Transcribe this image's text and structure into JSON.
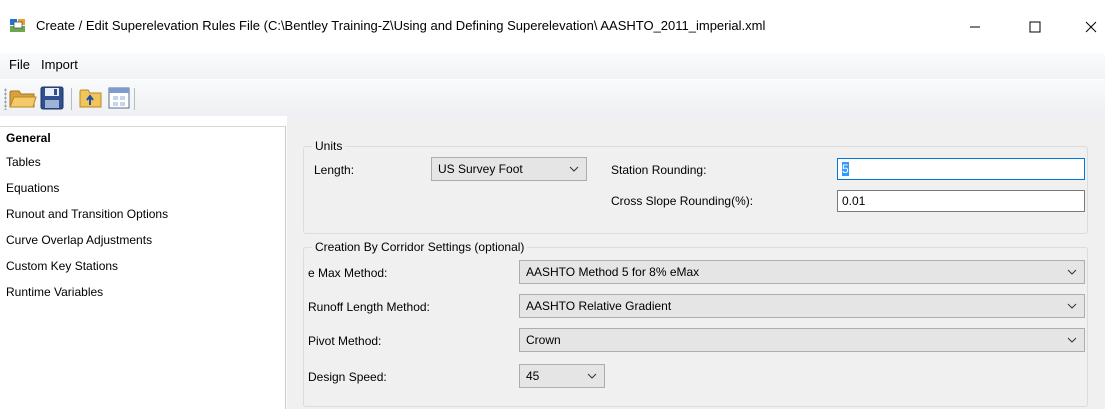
{
  "window": {
    "title": "Create / Edit Superelevation Rules File (C:\\Bentley Training-Z\\Using and Defining Superelevation\\ AASHTO_2011_imperial.xml"
  },
  "menu": {
    "file": "File",
    "import": "Import"
  },
  "toolbar": {
    "icons": [
      "open-folder-icon",
      "save-icon",
      "import-folder-icon",
      "table-icon"
    ]
  },
  "nav": {
    "items": [
      {
        "label": "General",
        "selected": true
      },
      {
        "label": "Tables"
      },
      {
        "label": "Equations"
      },
      {
        "label": "Runout and Transition Options"
      },
      {
        "label": "Curve Overlap Adjustments"
      },
      {
        "label": "Custom Key Stations"
      },
      {
        "label": "Runtime Variables"
      }
    ]
  },
  "units": {
    "group_title": "Units",
    "length_label": "Length:",
    "length_value": "US Survey Foot",
    "station_rounding_label": "Station Rounding:",
    "station_rounding_value": "5",
    "cross_slope_label": "Cross Slope Rounding(%):",
    "cross_slope_value": "0.01"
  },
  "corridor": {
    "group_title": "Creation By Corridor Settings (optional)",
    "emax_label": "e Max Method:",
    "emax_value": "AASHTO Method 5 for 8% eMax",
    "runoff_label": "Runoff Length Method:",
    "runoff_value": "AASHTO Relative Gradient",
    "pivot_label": "Pivot Method:",
    "pivot_value": "Crown",
    "speed_label": "Design Speed:",
    "speed_value": "45"
  },
  "colors": {
    "accent": "#0078d7",
    "selection": "#3399ff",
    "panel_bg": "#f0f0f0"
  }
}
